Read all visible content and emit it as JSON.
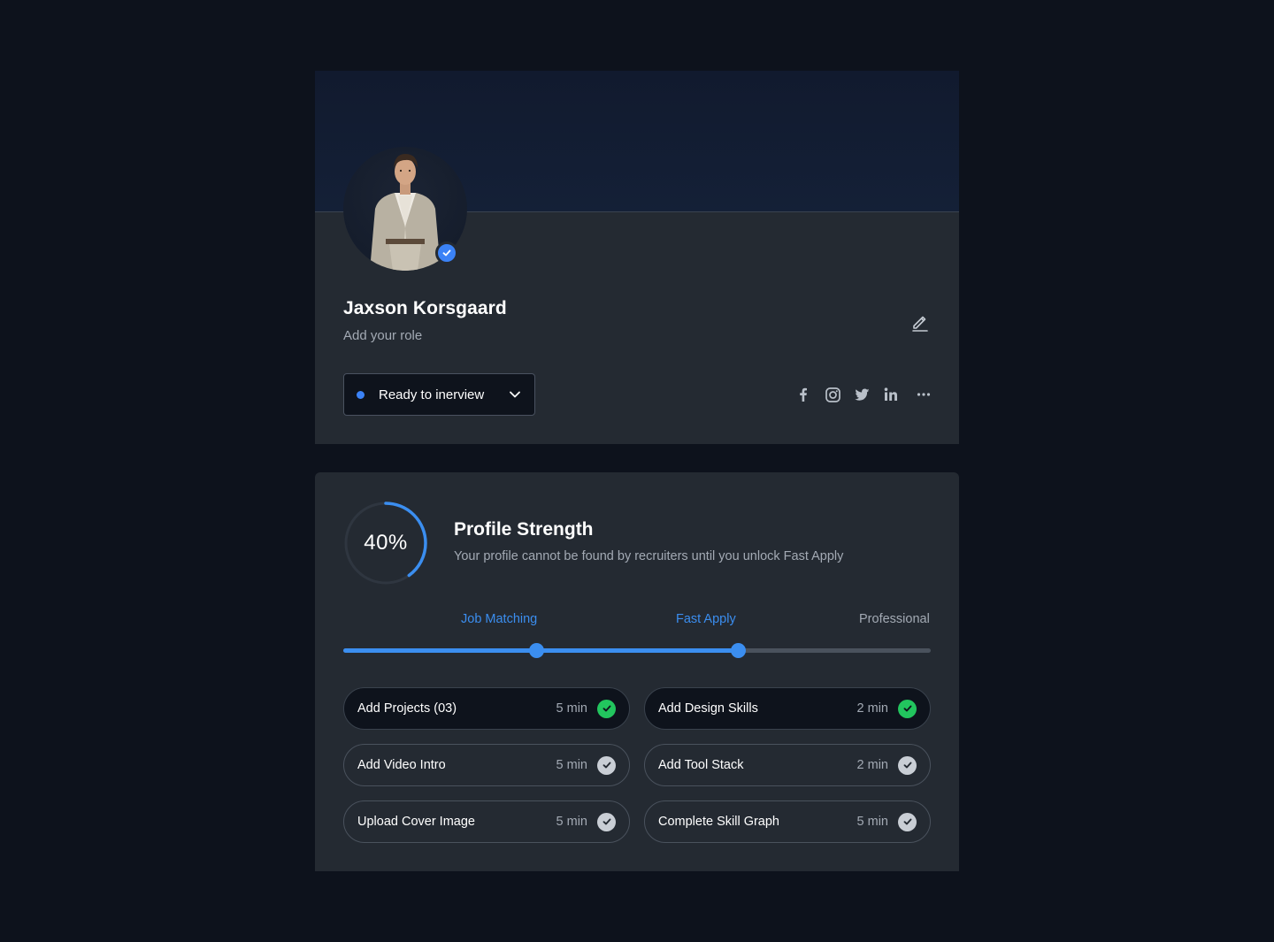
{
  "profile": {
    "name": "Jaxson Korsgaard",
    "role_placeholder": "Add your role",
    "verified": true,
    "status": {
      "label": "Ready to inerview",
      "dot_color": "#3b82f6"
    },
    "social_links": [
      {
        "icon": "facebook-icon"
      },
      {
        "icon": "instagram-icon"
      },
      {
        "icon": "twitter-icon"
      },
      {
        "icon": "linkedin-icon"
      },
      {
        "icon": "more-icon"
      }
    ]
  },
  "strength": {
    "percent": 40,
    "percent_label": "40%",
    "title": "Profile Strength",
    "subtitle": "Your profile cannot be found by recruiters until you unlock Fast Apply",
    "milestones": [
      {
        "label": "Job Matching",
        "reached": true
      },
      {
        "label": "Fast Apply",
        "reached": true
      },
      {
        "label": "Professional",
        "reached": false
      }
    ],
    "progress_fraction": 0.672,
    "tasks": [
      {
        "label": "Add Projects (03)",
        "time": "5 min",
        "complete": true
      },
      {
        "label": "Add Design Skills",
        "time": "2 min",
        "complete": true
      },
      {
        "label": "Add Video Intro",
        "time": "5 min",
        "complete": false
      },
      {
        "label": "Add Tool Stack",
        "time": "2 min",
        "complete": false
      },
      {
        "label": "Upload Cover Image",
        "time": "5 min",
        "complete": false
      },
      {
        "label": "Complete Skill Graph",
        "time": "5 min",
        "complete": false
      }
    ]
  },
  "colors": {
    "accent": "#3b8ef0",
    "success": "#22c55e",
    "background": "#0d121c",
    "card": "#242a32"
  }
}
